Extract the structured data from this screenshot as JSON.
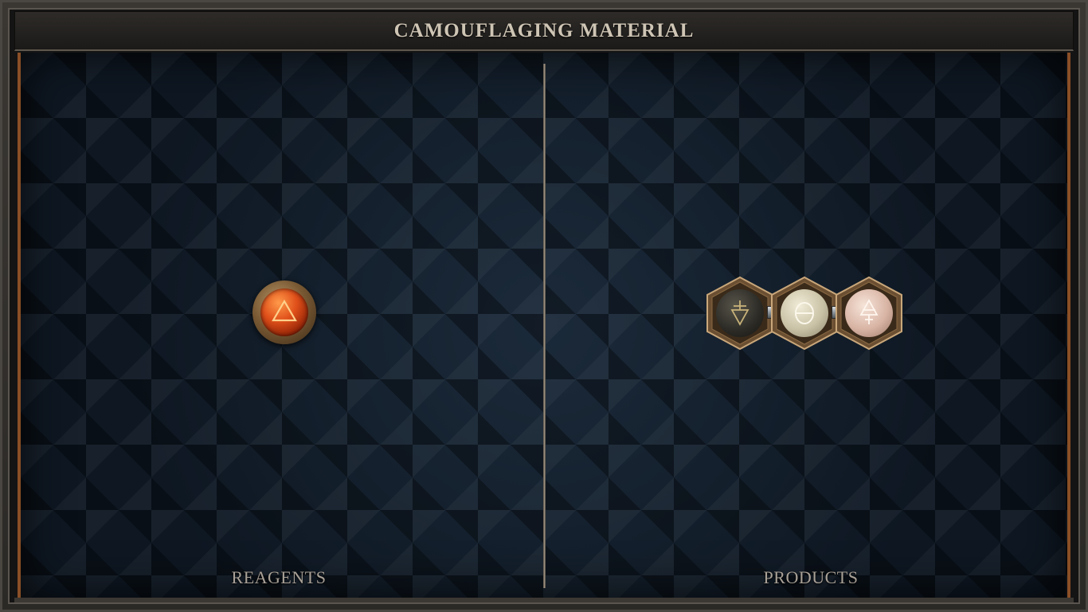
{
  "header": {
    "title": "CAMOUFLAGING MATERIAL"
  },
  "panels": {
    "reagents": {
      "label": "REAGENTS",
      "items": [
        {
          "icon": "fire-triangle-icon",
          "color": "#e0501a"
        }
      ]
    },
    "products": {
      "label": "PRODUCTS",
      "items": [
        {
          "icon": "earth-symbol-icon",
          "color": "#2b2a25"
        },
        {
          "icon": "theta-symbol-icon",
          "color": "#c9c2a6"
        },
        {
          "icon": "air-symbol-icon",
          "color": "#d8b4a4"
        }
      ]
    }
  },
  "colors": {
    "board": "#111a24",
    "frame_accent": "#8a4f26",
    "title_text": "#cfc5b5",
    "label_text": "#a9a197"
  }
}
